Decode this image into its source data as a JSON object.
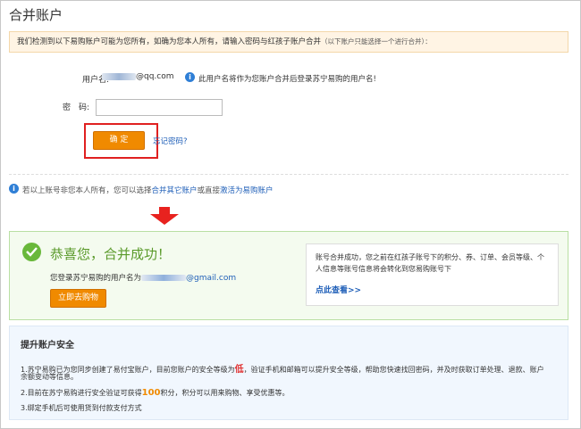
{
  "page": {
    "title": "合并账户",
    "notice": "我们检测到以下易购账户可能为您所有，如确为您本人所有，请输入密码与红孩子账户合并",
    "notice_small": "（以下账户只能选择一个进行合并）："
  },
  "form": {
    "username_label": "用户名:",
    "username_suffix": "@qq.com",
    "username_note": "此用户名将作为您账户合并后登录苏宁易购的用户名!",
    "password_label": "密　码:",
    "password_placeholder": "",
    "confirm_label": "确 定",
    "forgot_label": "忘记密码?"
  },
  "hint": {
    "prefix": "若以上账号非您本人所有，您可以选择",
    "link1": "合并其它账户",
    "middle": "或直接",
    "link2": "激活为易购账户"
  },
  "success": {
    "title": "恭喜您，合并成功！",
    "text_prefix": "您登录苏宁易购的用户名为",
    "email_suffix": "@gmail.com",
    "shop_label": "立即去购物",
    "detail": "账号合并成功，您之前在红孩子账号下的积分、券、订单、会员等级、个人信息等账号信息将会转化到您易购账号下",
    "view_label": "点此查看>>"
  },
  "security": {
    "title": "提升账户安全",
    "line1_a": "1.苏宁易购已为您同步创建了易付宝账户，目前您账户的安全等级为",
    "line1_level": "低",
    "line1_b": "，验证手机和邮箱可以提升安全等级，帮助您快速找回密码，并及时获取订单处理、退款、账户",
    "line1_c": "余额变动等信息。",
    "line2_a": "2.目前在苏宁易购进行安全验证可获得",
    "line2_points": "100",
    "line2_b": "积分，积分可以用来购物、享受优惠等。",
    "line3": "3.绑定手机后可使用货到付款支付方式"
  },
  "colors": {
    "accent": "#f08a00",
    "link": "#1f5fb8",
    "success": "#5a9a2a",
    "highlight_box": "#e02020"
  }
}
